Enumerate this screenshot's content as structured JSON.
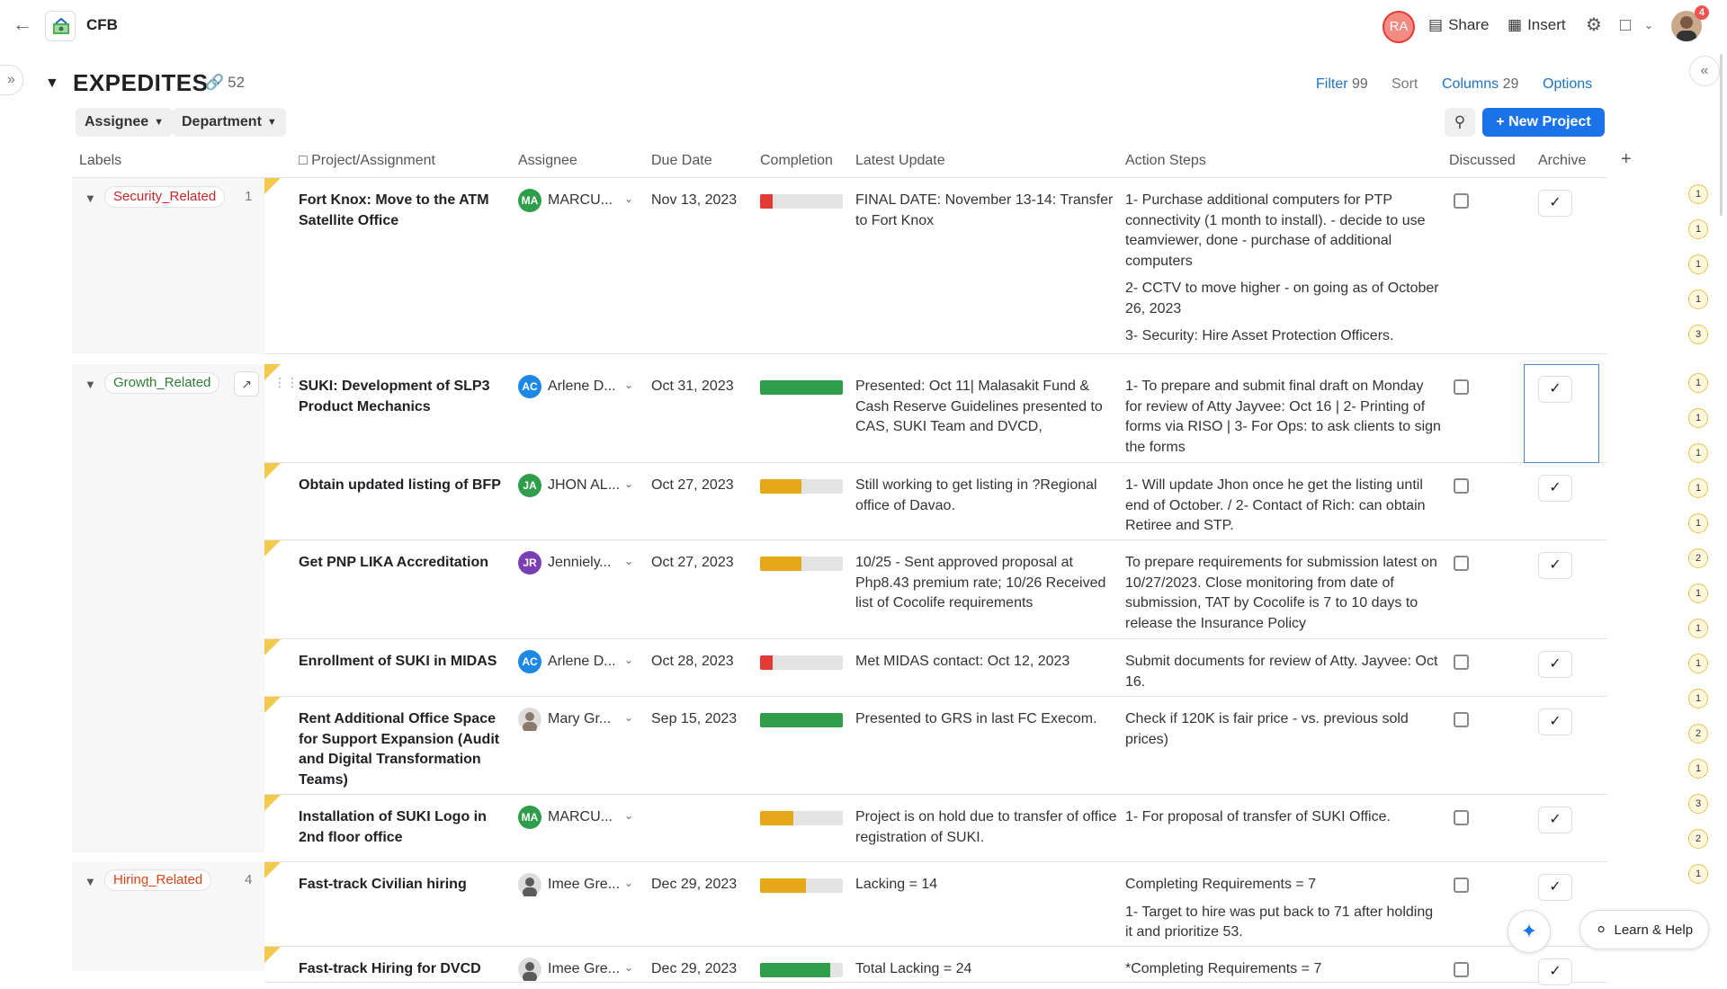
{
  "app": {
    "doc_title": "CFB"
  },
  "topbar": {
    "avatar_initials": "RA",
    "share_label": "Share",
    "insert_label": "Insert",
    "notifications": "4"
  },
  "table": {
    "title": "EXPEDITES",
    "link_count": "52",
    "filter_label": "Filter",
    "filter_count": "99",
    "sort_label": "Sort",
    "columns_label": "Columns",
    "columns_count": "29",
    "options_label": "Options",
    "group_chips": [
      "Assignee",
      "Department"
    ],
    "new_project_label": "New Project",
    "columns": [
      "Labels",
      "Project/Assignment",
      "Assignee",
      "Due Date",
      "Completion",
      "Latest Update",
      "Action Steps",
      "Discussed",
      "Archive"
    ]
  },
  "colors": {
    "accent": "#1a73e8",
    "red": "#e53935",
    "green": "#2e9e4b",
    "amber": "#e6a817",
    "blue": "#1e88e5",
    "purple": "#7b3fb5"
  },
  "groups": [
    {
      "label": "Security_Related",
      "label_color": "#c62828",
      "count": "1"
    },
    {
      "label": "Growth_Related",
      "label_color": "#2e7d32",
      "count": ""
    },
    {
      "label": "Hiring_Related",
      "label_color": "#d84315",
      "count": "4"
    }
  ],
  "rows": [
    {
      "project": "Fort Knox: Move to the ATM Satellite Office",
      "initials": "MA",
      "avatar_color": "#2e9e4b",
      "assignee": "MARCU...",
      "due": "Nov 13, 2023",
      "completion": 0.15,
      "bar_color": "#e53935",
      "update": "FINAL DATE: November 13-14: Transfer to Fort Knox",
      "actions": [
        "1- Purchase additional computers for PTP connectivity (1 month to install).  - decide to use teamviewer, done - purchase of additional computers",
        "2- CCTV to move higher - on going as of October 26, 2023",
        "3- Security: Hire Asset Protection Officers."
      ]
    },
    {
      "project": "SUKI: Development of SLP3 Product Mechanics",
      "initials": "AC",
      "avatar_color": "#1e88e5",
      "assignee": "Arlene D...",
      "due": "Oct 31, 2023",
      "completion": 1.0,
      "bar_color": "#2e9e4b",
      "update": "Presented: Oct 11| Malasakit Fund & Cash Reserve Guidelines presented to CAS, SUKI Team and DVCD,",
      "actions": [
        "1- To prepare and submit final draft on Monday for review of Atty Jayvee: Oct 16 | 2- Printing of forms via RISO | 3- For Ops: to ask clients to sign the forms"
      ]
    },
    {
      "project": "Obtain updated listing of BFP",
      "initials": "JA",
      "avatar_color": "#2e9e4b",
      "assignee": "JHON AL...",
      "due": "Oct 27, 2023",
      "completion": 0.5,
      "bar_color": "#e6a817",
      "update": "Still working to get listing in ?Regional office of Davao.",
      "actions": [
        "1- Will update Jhon once he get the listing until end of October. / 2- Contact of Rich: can obtain Retiree and STP."
      ]
    },
    {
      "project": "Get PNP LIKA Accreditation",
      "initials": "JR",
      "avatar_color": "#7b3fb5",
      "assignee": "Jennielу...",
      "due": "Oct 27, 2023",
      "completion": 0.5,
      "bar_color": "#e6a817",
      "update": "10/25 - Sent approved proposal at Php8.43 premium rate; 10/26 Received list of Cocolife requirements",
      "actions": [
        "To prepare requirements for submission latest on 10/27/2023. Close monitoring from date of submission, TAT by Cocolife is 7 to 10 days to release the Insurance Policy"
      ]
    },
    {
      "project": "Enrollment of SUKI in MIDAS",
      "initials": "AC",
      "avatar_color": "#1e88e5",
      "assignee": "Arlene D...",
      "due": "Oct 28, 2023",
      "completion": 0.15,
      "bar_color": "#e53935",
      "update": "Met MIDAS contact: Oct 12, 2023",
      "actions": [
        "Submit documents for review of Atty. Jayvee: Oct 16."
      ]
    },
    {
      "project": "Rent Additional Office Space for Support Expansion (Audit and Digital Transformation Teams)",
      "initials": "",
      "avatar_color": "#8a7a6a",
      "assignee": "Mary Gr...",
      "due": "Sep 15, 2023",
      "completion": 1.0,
      "bar_color": "#2e9e4b",
      "update": "Presented to GRS in last FC Execom.",
      "actions": [
        "Check if 120K is fair price - vs. previous sold prices)"
      ]
    },
    {
      "project": "Installation of SUKI Logo in 2nd floor office",
      "initials": "MA",
      "avatar_color": "#2e9e4b",
      "assignee": "MARCU...",
      "due": "",
      "completion": 0.4,
      "bar_color": "#e6a817",
      "update": "Project is on hold due to transfer of office registration of SUKI.",
      "actions": [
        "1- For proposal of transfer of SUKI Office."
      ]
    },
    {
      "project": "Fast-track Civilian hiring",
      "initials": "",
      "avatar_color": "#5a5a5a",
      "assignee": "Imee Gre...",
      "due": "Dec 29, 2023",
      "completion": 0.55,
      "bar_color": "#e6a817",
      "update": "Lacking = 14",
      "actions": [
        "Completing Requirements = 7",
        "1- Target to hire was put back to 71 after holding it and prioritize 53."
      ]
    },
    {
      "project": "Fast-track Hiring for DVCD",
      "initials": "",
      "avatar_color": "#5a5a5a",
      "assignee": "Imee Gre...",
      "due": "Dec 29, 2023",
      "completion": 0.85,
      "bar_color": "#2e9e4b",
      "update": "Total Lacking = 24",
      "actions": [
        "*Completing Requirements = 7"
      ]
    }
  ],
  "comment_counts": [
    "1",
    "1",
    "1",
    "1",
    "3",
    "1",
    "1",
    "1",
    "1",
    "1",
    "2",
    "1",
    "1",
    "1",
    "1",
    "2",
    "1",
    "3",
    "2",
    "1"
  ],
  "floating": {
    "help_label": "Learn & Help"
  }
}
